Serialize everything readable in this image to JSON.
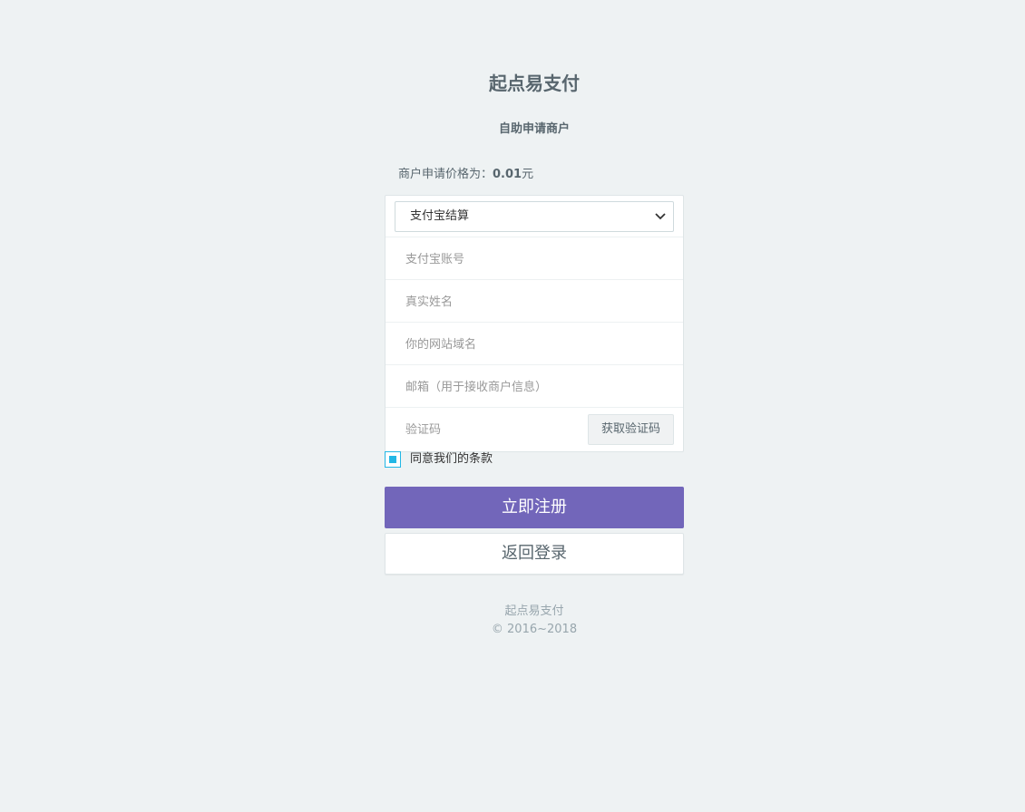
{
  "header": {
    "title": "起点易支付",
    "subtitle": "自助申请商户"
  },
  "price": {
    "label": "商户申请价格为：",
    "value": "0.01",
    "unit": "元"
  },
  "form": {
    "settlement_select": {
      "selected": "支付宝结算"
    },
    "account_placeholder": "支付宝账号",
    "name_placeholder": "真实姓名",
    "domain_placeholder": "你的网站域名",
    "email_placeholder": "邮箱（用于接收商户信息）",
    "code_placeholder": "验证码",
    "get_code_label": "获取验证码"
  },
  "agreement": {
    "label": "同意我们的条款",
    "checked": true
  },
  "buttons": {
    "register_label": "立即注册",
    "back_label": "返回登录"
  },
  "footer": {
    "brand": "起点易支付",
    "copyright": "© 2016~2018"
  },
  "colors": {
    "background": "#eef2f3",
    "primary": "#7266ba",
    "checkbox_accent": "#23b7e5",
    "text": "#58666e"
  }
}
